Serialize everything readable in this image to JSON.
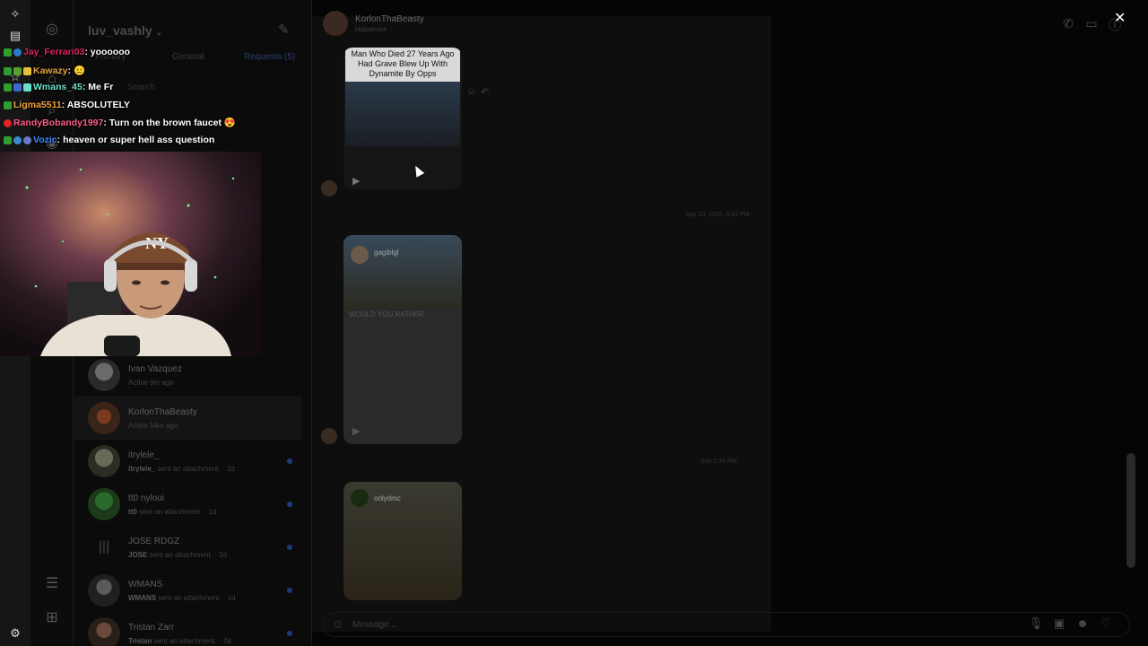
{
  "inbox": {
    "username": "luv_vashly",
    "tabs": [
      "Primary",
      "General",
      "Requests (5)"
    ],
    "search_placeholder": "Search",
    "conversations": [
      {
        "name": "Ivan Vazquez",
        "sub": "Active 9m ago",
        "active": false,
        "unread": false
      },
      {
        "name": "KorlonThaBeasty",
        "sub": "Active 54m ago",
        "active": true,
        "unread": false
      },
      {
        "name": "itrylele_",
        "sub_name": "itrylele_",
        "sub": "sent an attachment.",
        "time": "1d",
        "unread": true
      },
      {
        "name": "tt0 nyloui",
        "sub_name": "tt0",
        "sub": "sent an attachment.",
        "time": "1d",
        "unread": true
      },
      {
        "name": "JOSE RDGZ",
        "sub_name": "JOSE",
        "sub": "sent an attachment.",
        "time": "1d",
        "unread": true
      },
      {
        "name": "WMANS",
        "sub_name": "WMANS",
        "sub": "sent an attachment.",
        "time": "1d",
        "unread": true
      },
      {
        "name": "Tristan Zarr",
        "sub_name": "Tristan",
        "sub": "sent an attachment.",
        "time": "2d",
        "unread": true
      }
    ]
  },
  "thread": {
    "name": "KorlonThaBeasty",
    "handle": "kkilpatrick4",
    "cards": [
      {
        "caption": "Man Who Died 27 Years Ago Had Grave Blew Up With Dynamite By Opps",
        "author": ""
      },
      {
        "caption": "WOULD YOU RATHER",
        "author": "gagiblgl"
      },
      {
        "caption": "",
        "author": "onlydmc"
      }
    ],
    "timestamps": [
      "Sep 10, 2025, 5:32 PM",
      "Sun 2:44 PM"
    ],
    "message_placeholder": "Message..."
  },
  "stream_chat": [
    {
      "user": "Jay_Ferrari03",
      "msg": ": yoooooo",
      "color": "#e0245e"
    },
    {
      "user": "Kawazy",
      "msg": ": 😐",
      "color": "#e6a23c"
    },
    {
      "user": "Wmans_45",
      "msg": ": Me Fr",
      "color": "#6be0c9"
    },
    {
      "user": "Ligma5511",
      "msg": ": ABSOLUTELY",
      "color": "#f0a23c"
    },
    {
      "user": "RandyBobandy1997",
      "msg": ": Turn on the brown faucet 😍",
      "color": "#ff5c8a"
    },
    {
      "user": "Vozic",
      "msg": ": heaven or super hell ass question",
      "color": "#3d8bff"
    }
  ],
  "colors": {
    "accent_blue": "#1e3a7a",
    "background": "#000000",
    "panel": "#0b0b0b"
  }
}
